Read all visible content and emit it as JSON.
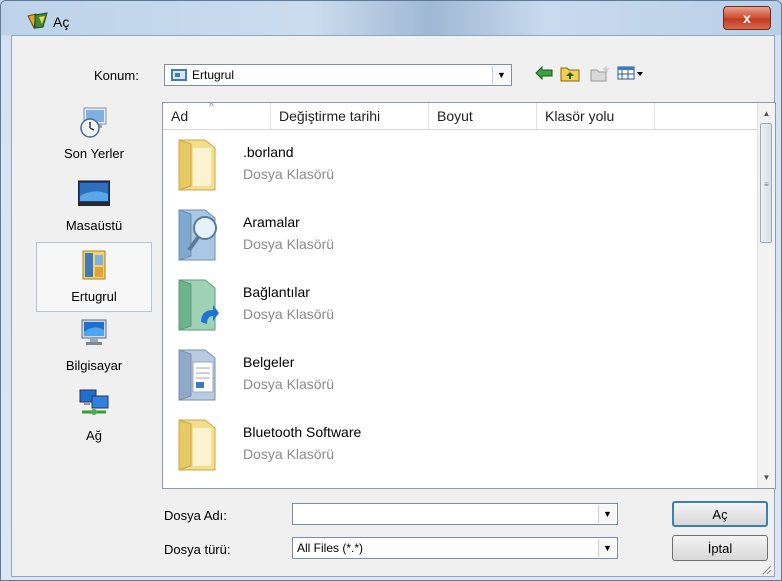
{
  "window": {
    "title": "Aç",
    "close_label": "x"
  },
  "location": {
    "label": "Konum:",
    "value": "Ertugrul"
  },
  "places": [
    {
      "label": "Son Yerler",
      "icon": "recent-places-icon",
      "selected": false
    },
    {
      "label": "Masaüstü",
      "icon": "desktop-icon",
      "selected": false
    },
    {
      "label": "Ertugrul",
      "icon": "user-folder-icon",
      "selected": true
    },
    {
      "label": "Bilgisayar",
      "icon": "computer-icon",
      "selected": false
    },
    {
      "label": "Ağ",
      "icon": "network-icon",
      "selected": false
    }
  ],
  "columns": [
    "Ad",
    "Değiştirme tarihi",
    "Boyut",
    "Klasör yolu"
  ],
  "files": [
    {
      "name": ".borland",
      "type": "Dosya Klasörü",
      "icon": "plain-folder-icon"
    },
    {
      "name": "Aramalar",
      "type": "Dosya Klasörü",
      "icon": "searches-folder-icon"
    },
    {
      "name": "Bağlantılar",
      "type": "Dosya Klasörü",
      "icon": "links-folder-icon"
    },
    {
      "name": "Belgeler",
      "type": "Dosya Klasörü",
      "icon": "documents-folder-icon"
    },
    {
      "name": "Bluetooth Software",
      "type": "Dosya Klasörü",
      "icon": "plain-folder-icon"
    }
  ],
  "filename": {
    "label": "Dosya Adı:",
    "value": ""
  },
  "filetype": {
    "label": "Dosya türü:",
    "value": "All Files (*.*)"
  },
  "buttons": {
    "open": "Aç",
    "cancel": "İptal"
  },
  "colors": {
    "title_close": "#c13b22",
    "selection_border": "#3c7fb1"
  }
}
